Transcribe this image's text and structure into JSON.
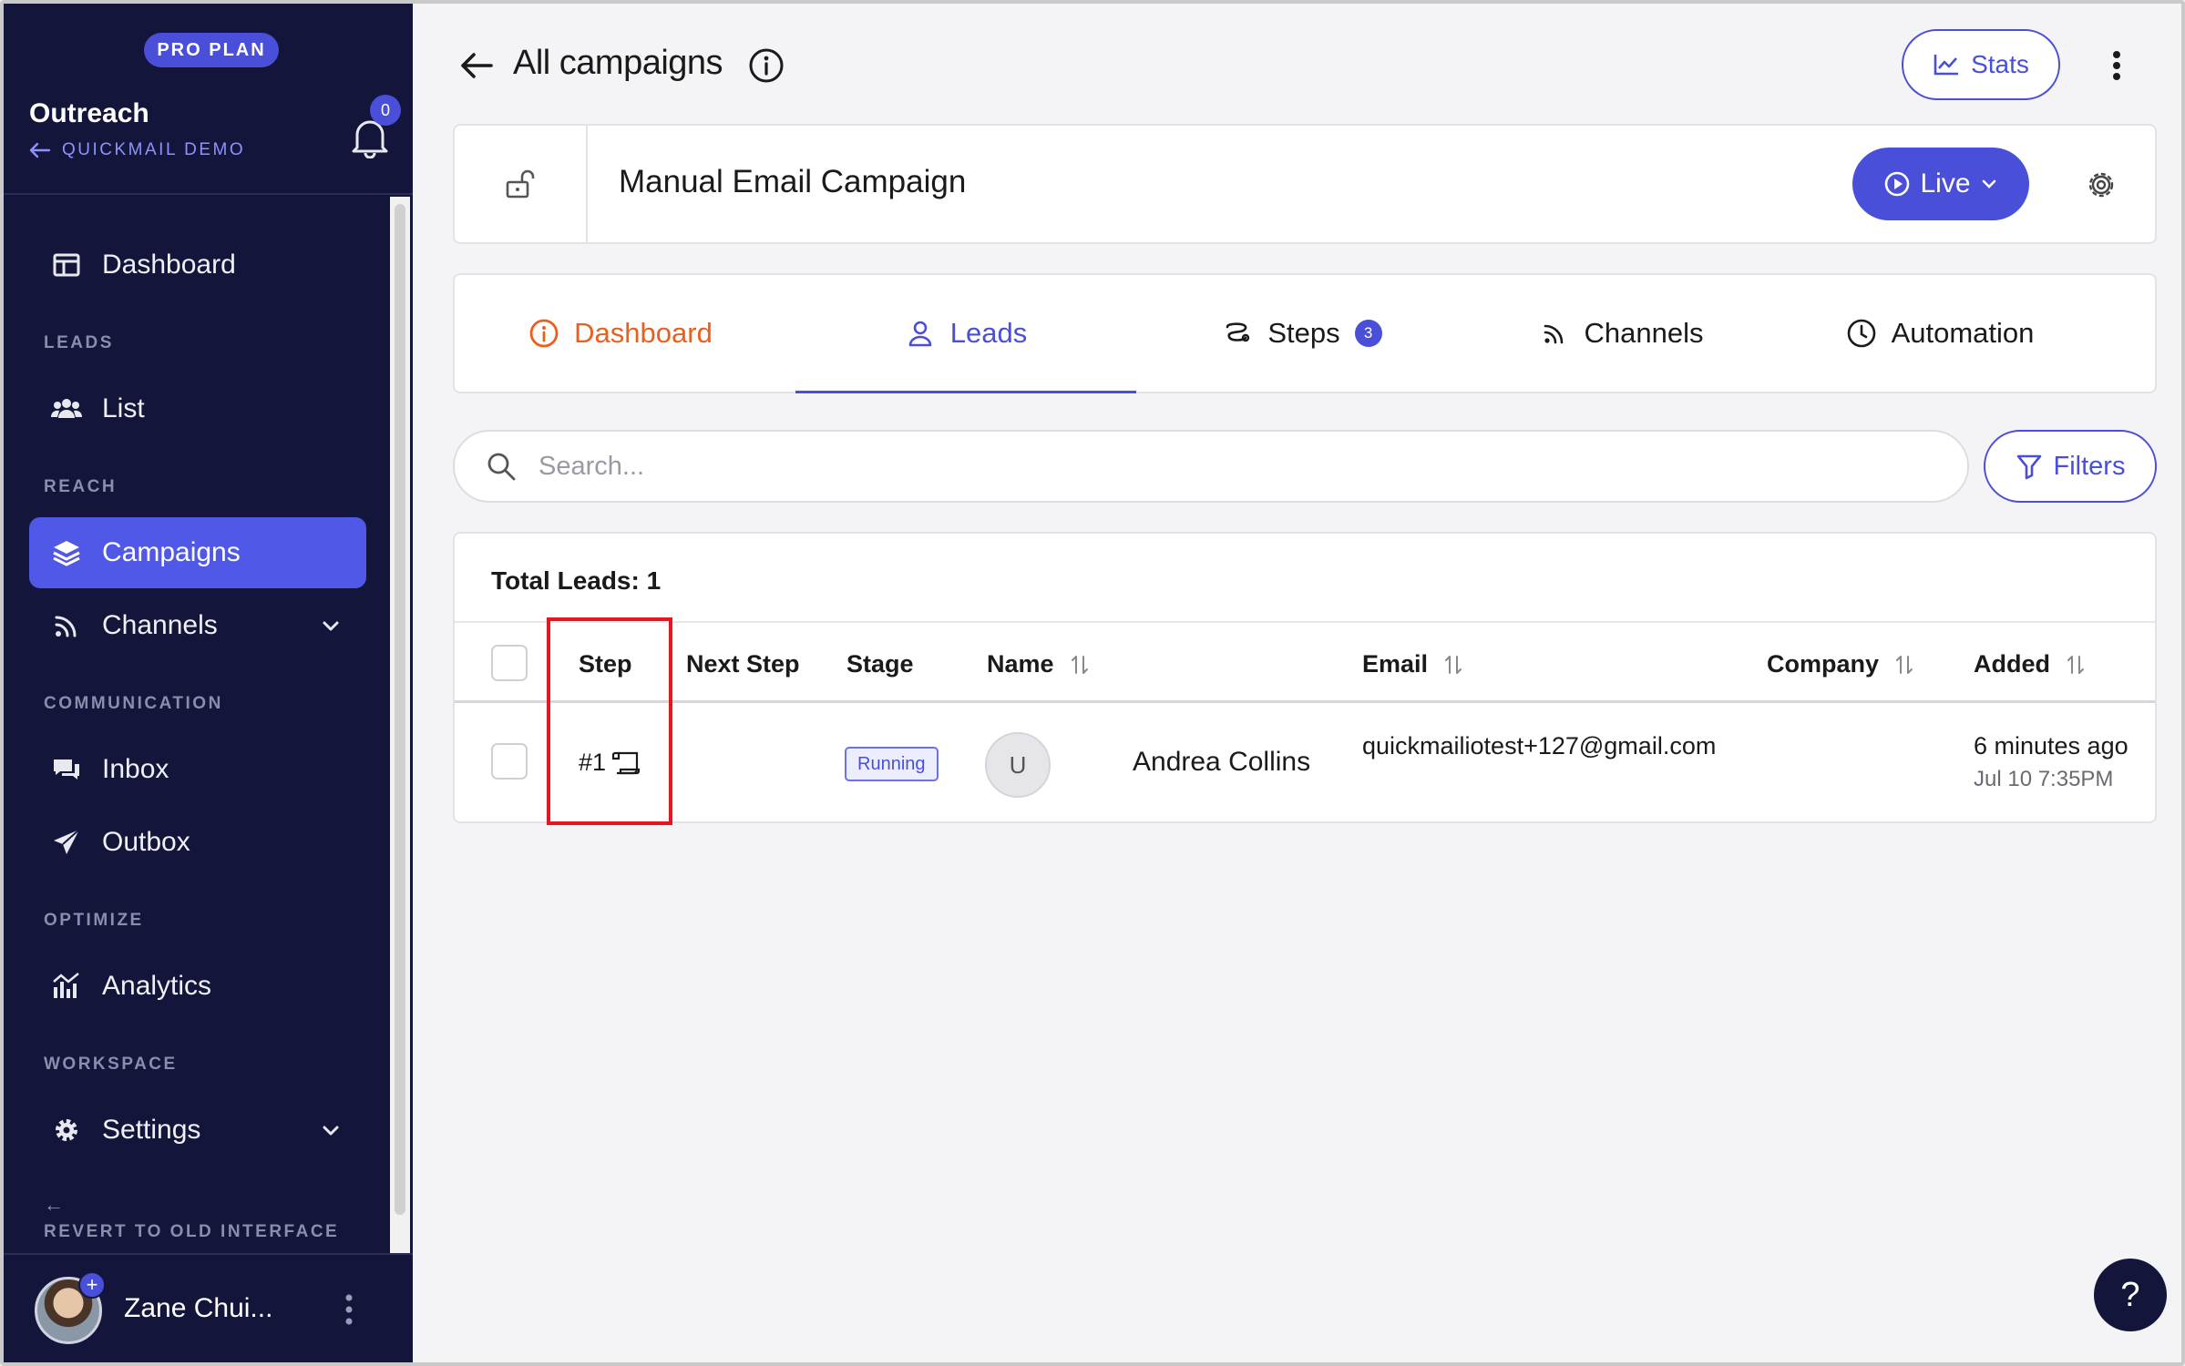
{
  "sidebar": {
    "plan_badge": "PRO PLAN",
    "org_name": "Outreach",
    "org_sub": "QUICKMAIL DEMO",
    "notifications_count": "0",
    "sections": {
      "leads": "LEADS",
      "reach": "REACH",
      "communication": "COMMUNICATION",
      "optimize": "OPTIMIZE",
      "workspace": "WORKSPACE"
    },
    "items": {
      "dashboard": "Dashboard",
      "list": "List",
      "campaigns": "Campaigns",
      "channels": "Channels",
      "inbox": "Inbox",
      "outbox": "Outbox",
      "analytics": "Analytics",
      "settings": "Settings"
    },
    "active_item": "Campaigns",
    "revert_label": "REVERT TO OLD INTERFACE",
    "user_name": "Zane Chui..."
  },
  "header": {
    "title": "All campaigns",
    "stats_label": "Stats"
  },
  "campaign": {
    "name": "Manual Email Campaign",
    "status_label": "Live"
  },
  "tabs": [
    {
      "label": "Dashboard",
      "icon": "info-circle-icon"
    },
    {
      "label": "Leads",
      "icon": "user-icon"
    },
    {
      "label": "Steps",
      "icon": "steps-icon",
      "badge": "3"
    },
    {
      "label": "Channels",
      "icon": "rss-icon"
    },
    {
      "label": "Automation",
      "icon": "clock-icon"
    }
  ],
  "active_tab": "Leads",
  "search": {
    "placeholder": "Search...",
    "value": ""
  },
  "filters_label": "Filters",
  "table": {
    "total_leads": "Total Leads: 1",
    "columns": [
      "Step",
      "Next Step",
      "Stage",
      "Name",
      "Email",
      "Company",
      "Added"
    ],
    "rows": [
      {
        "step": "#1",
        "next_step": "",
        "stage": "Running",
        "avatar_initial": "U",
        "name": "Andrea Collins",
        "email": "quickmailiotest+127@gmail.com",
        "company": "",
        "added_relative": "6 minutes ago",
        "added_date": "Jul 10 7:35PM"
      }
    ]
  },
  "help_label": "?",
  "colors": {
    "sidebar_bg": "#14153a",
    "accent": "#4a4fd9",
    "dashboard_tab": "#ea5f1c",
    "highlight": "#e8141e"
  }
}
